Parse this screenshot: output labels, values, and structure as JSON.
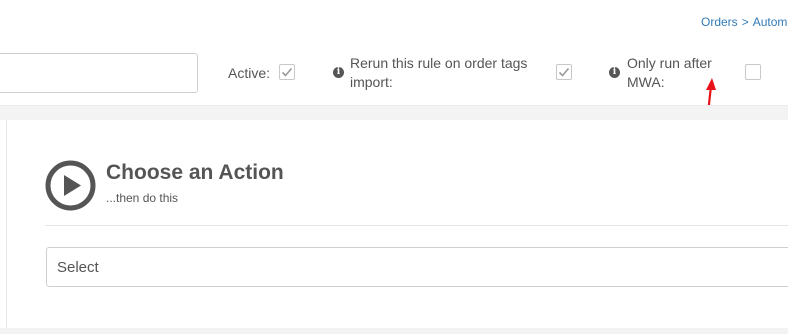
{
  "breadcrumb": {
    "item1": "Orders",
    "separator": ">",
    "item2": "Automa"
  },
  "rule_form": {
    "active": {
      "label": "Active:",
      "checked": true
    },
    "rerun_on_tags_import": {
      "label_line1": "Rerun this rule on order tags",
      "label_line2": "import:",
      "checked": true,
      "icon": "info-icon"
    },
    "only_run_after_mwa": {
      "label_line1": "Only run after",
      "label_line2": "MWA:",
      "checked": false,
      "icon": "info-icon"
    }
  },
  "action_section": {
    "icon": "play-circle-icon",
    "title": "Choose an Action",
    "subtitle": "...then do this",
    "select_value": "Select"
  },
  "annotation": {
    "icon": "red-arrow",
    "color": "#e8121b"
  }
}
